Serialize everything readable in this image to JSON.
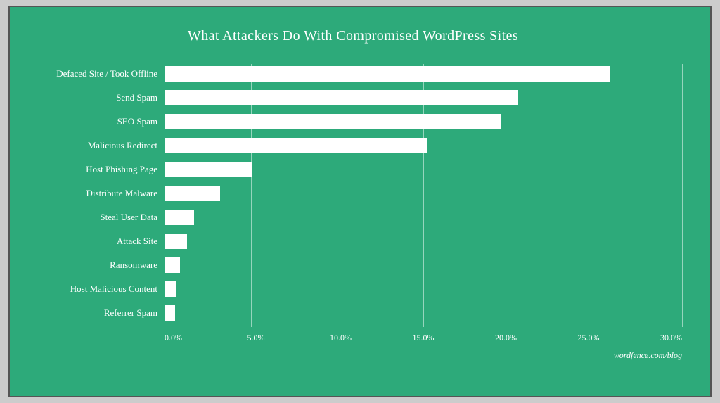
{
  "chart": {
    "title": "What Attackers Do With Compromised WordPress Sites",
    "watermark": "wordfence.com/blog",
    "max_value": 30,
    "x_ticks": [
      "0.0%",
      "5.0%",
      "10.0%",
      "15.0%",
      "20.0%",
      "25.0%",
      "30.0%"
    ],
    "bars": [
      {
        "label": "Defaced Site / Took Offline",
        "value": 25.8
      },
      {
        "label": "Send Spam",
        "value": 20.5
      },
      {
        "label": "SEO Spam",
        "value": 19.5
      },
      {
        "label": "Malicious Redirect",
        "value": 15.2
      },
      {
        "label": "Host Phishing Page",
        "value": 5.1
      },
      {
        "label": "Distribute Malware",
        "value": 3.2
      },
      {
        "label": "Steal User Data",
        "value": 1.7
      },
      {
        "label": "Attack Site",
        "value": 1.3
      },
      {
        "label": "Ransomware",
        "value": 0.9
      },
      {
        "label": "Host Malicious Content",
        "value": 0.7
      },
      {
        "label": "Referrer Spam",
        "value": 0.6
      }
    ]
  }
}
